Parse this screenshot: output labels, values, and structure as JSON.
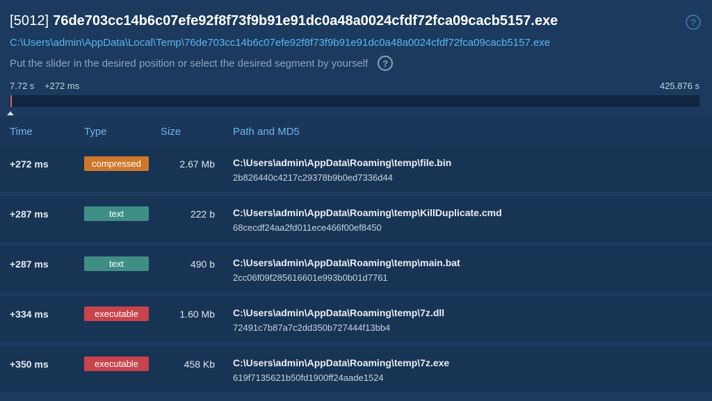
{
  "header": {
    "pid": "[5012]",
    "process_name": "76de703cc14b6c07efe92f8f73f9b91e91dc0a48a0024cfdf72fca09cacb5157.exe",
    "path": "C:\\Users\\admin\\AppData\\Local\\Temp\\76de703cc14b6c07efe92f8f73f9b91e91dc0a48a0024cfdf72fca09cacb5157.exe",
    "instruction": "Put the slider in the desired position or select the desired segment by yourself",
    "help_symbol": "?"
  },
  "slider": {
    "start_label": "7.72 s",
    "offset_label": "+272 ms",
    "end_label": "425.876 s",
    "marker_color": "#e0647a"
  },
  "table": {
    "columns": {
      "time": "Time",
      "type": "Type",
      "size": "Size",
      "path": "Path and MD5"
    },
    "rows": [
      {
        "time": "+272 ms",
        "type": "compressed",
        "size": "2.67 Mb",
        "path": "C:\\Users\\admin\\AppData\\Roaming\\temp\\file.bin",
        "md5": "2b826440c4217c29378b9b0ed7336d44"
      },
      {
        "time": "+287 ms",
        "type": "text",
        "size": "222 b",
        "path": "C:\\Users\\admin\\AppData\\Roaming\\temp\\KillDuplicate.cmd",
        "md5": "68cecdf24aa2fd011ece466f00ef8450"
      },
      {
        "time": "+287 ms",
        "type": "text",
        "size": "490 b",
        "path": "C:\\Users\\admin\\AppData\\Roaming\\temp\\main.bat",
        "md5": "2cc06f09f285616601e993b0b01d7761"
      },
      {
        "time": "+334 ms",
        "type": "executable",
        "size": "1.60 Mb",
        "path": "C:\\Users\\admin\\AppData\\Roaming\\temp\\7z.dll",
        "md5": "72491c7b87a7c2dd350b727444f13bb4"
      },
      {
        "time": "+350 ms",
        "type": "executable",
        "size": "458 Kb",
        "path": "C:\\Users\\admin\\AppData\\Roaming\\temp\\7z.exe",
        "md5": "619f7135621b50fd1900ff24aade1524"
      }
    ]
  },
  "colors": {
    "background": "#1b3a5e",
    "link": "#5cb6f0",
    "compressed": "#d0782a",
    "text": "#3f8e85",
    "executable": "#c8434b"
  }
}
